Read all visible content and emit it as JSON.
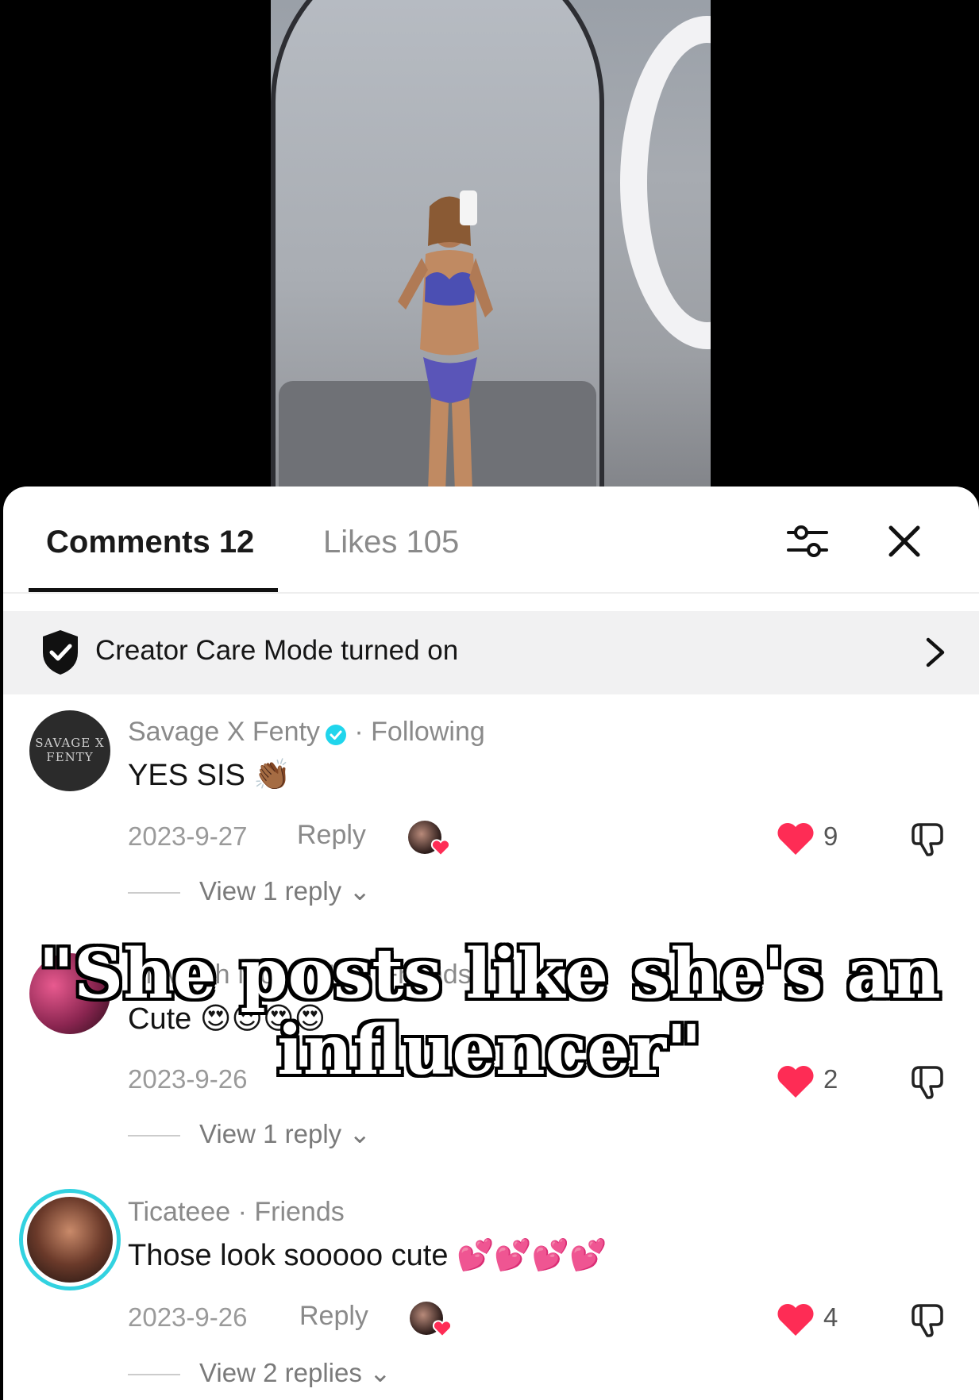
{
  "tabs": {
    "comments": "Comments 12",
    "likes": "Likes 105"
  },
  "icons": {
    "filter": "sliders-icon",
    "close": "close-icon"
  },
  "care_banner": {
    "text": "Creator Care Mode turned on"
  },
  "comments": [
    {
      "avatar_text": "SAVAGE X FENTY",
      "username": "Savage X Fenty",
      "verified": true,
      "relation": " · Following",
      "text": "YES SIS 👏🏾",
      "date": "2023-9-27",
      "reply_label": "Reply",
      "likes": "9",
      "view_replies": "View 1 reply ⌄"
    },
    {
      "username": "Sieviyah Mone M... · Friends",
      "text": "Cute 😍😍😍😍",
      "date": "2023-9-26",
      "likes": "2",
      "view_replies": "View 1 reply ⌄"
    },
    {
      "username": "Ticateee",
      "relation": " · Friends",
      "text": "Those look sooooo cute 💕💕💕💕",
      "date": "2023-9-26",
      "reply_label": "Reply",
      "likes": "4",
      "view_replies": "View 2 replies ⌄"
    }
  ],
  "caption": {
    "line1": "\"She posts like she's an",
    "line2": "influencer\""
  },
  "colors": {
    "heart": "#fe2c55",
    "verified": "#20d5ec",
    "ring": "#32d2e0"
  }
}
